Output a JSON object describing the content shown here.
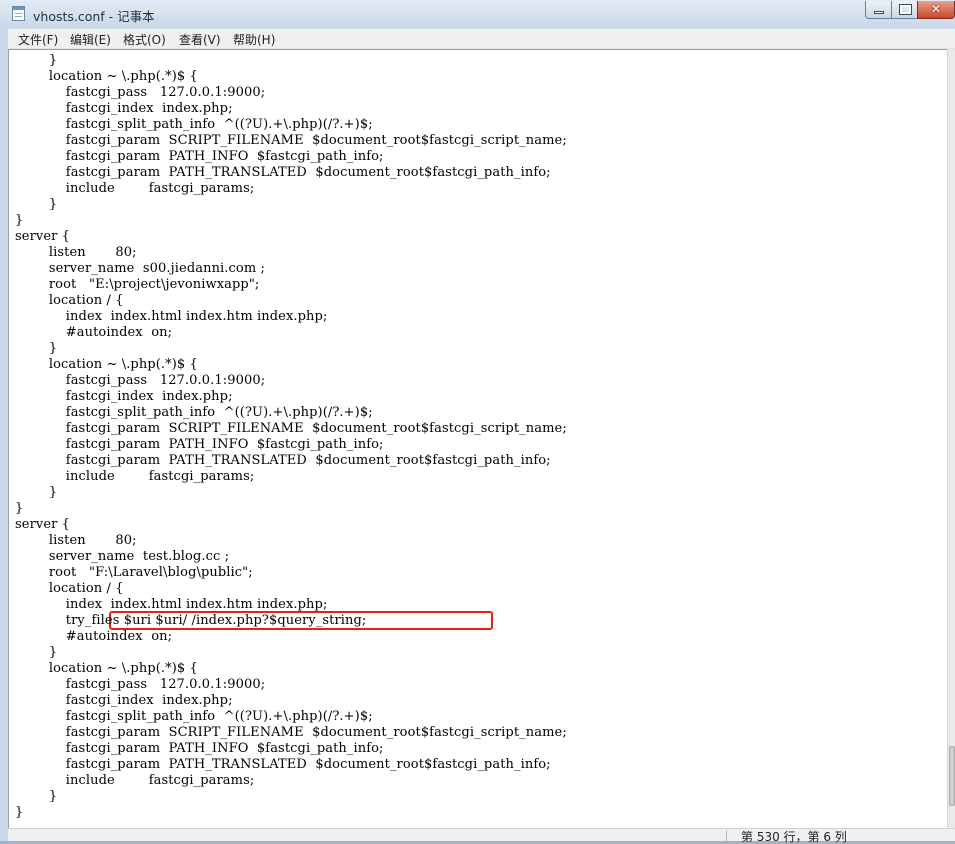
{
  "window": {
    "title": "vhosts.conf - 记事本",
    "controls": {
      "minimize": "minimize",
      "maximize": "maximize",
      "close": "✕"
    }
  },
  "menu": [
    {
      "label": "文件(F)"
    },
    {
      "label": "编辑(E)"
    },
    {
      "label": "格式(O)"
    },
    {
      "label": "查看(V)"
    },
    {
      "label": "帮助(H)"
    }
  ],
  "editor": {
    "lines": [
      "        }",
      "        location ~ \\.php(.*)$ {",
      "            fastcgi_pass   127.0.0.1:9000;",
      "            fastcgi_index  index.php;",
      "            fastcgi_split_path_info  ^((?U).+\\.php)(/?.+)$;",
      "            fastcgi_param  SCRIPT_FILENAME  $document_root$fastcgi_script_name;",
      "            fastcgi_param  PATH_INFO  $fastcgi_path_info;",
      "            fastcgi_param  PATH_TRANSLATED  $document_root$fastcgi_path_info;",
      "            include        fastcgi_params;",
      "        }",
      "}",
      "server {",
      "        listen       80;",
      "        server_name  s00.jiedanni.com ;",
      "        root   \"E:\\project\\jevoniwxapp\";",
      "        location / {",
      "            index  index.html index.htm index.php;",
      "            #autoindex  on;",
      "        }",
      "        location ~ \\.php(.*)$ {",
      "            fastcgi_pass   127.0.0.1:9000;",
      "            fastcgi_index  index.php;",
      "            fastcgi_split_path_info  ^((?U).+\\.php)(/?.+)$;",
      "            fastcgi_param  SCRIPT_FILENAME  $document_root$fastcgi_script_name;",
      "            fastcgi_param  PATH_INFO  $fastcgi_path_info;",
      "            fastcgi_param  PATH_TRANSLATED  $document_root$fastcgi_path_info;",
      "            include        fastcgi_params;",
      "        }",
      "}",
      "server {",
      "        listen       80;",
      "        server_name  test.blog.cc ;",
      "        root   \"F:\\Laravel\\blog\\public\";",
      "        location / {",
      "            index  index.html index.htm index.php;",
      "            try_files $uri $uri/ /index.php?$query_string;",
      "            #autoindex  on;",
      "        }",
      "        location ~ \\.php(.*)$ {",
      "            fastcgi_pass   127.0.0.1:9000;",
      "            fastcgi_index  index.php;",
      "            fastcgi_split_path_info  ^((?U).+\\.php)(/?.+)$;",
      "            fastcgi_param  SCRIPT_FILENAME  $document_root$fastcgi_script_name;",
      "            fastcgi_param  PATH_INFO  $fastcgi_path_info;",
      "            fastcgi_param  PATH_TRANSLATED  $document_root$fastcgi_path_info;",
      "            include        fastcgi_params;",
      "        }",
      "}"
    ],
    "highlighted_line": 35,
    "highlight_color": "#e8201a"
  },
  "statusbar": {
    "position": "第 530 行，第 6 列"
  }
}
